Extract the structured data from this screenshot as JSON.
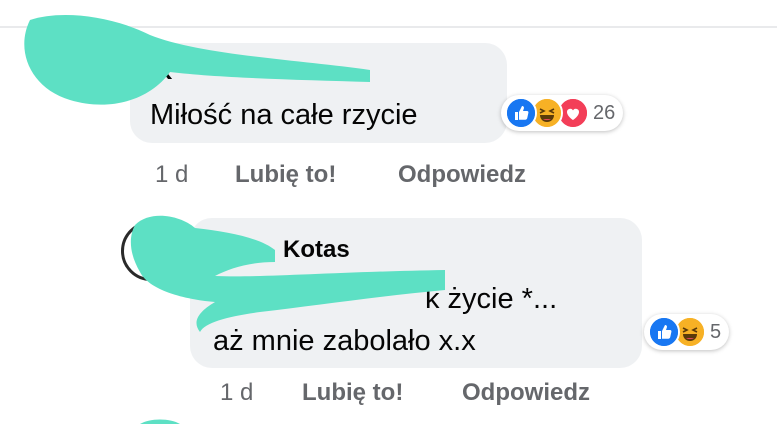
{
  "comments": [
    {
      "author": "K",
      "text": "Miłość na całe rzycie",
      "time": "1 d",
      "like_label": "Lubię to!",
      "reply_label": "Odpowiedz",
      "reaction_count": "26",
      "reaction_icons": [
        "like-icon",
        "haha-icon",
        "love-icon"
      ]
    },
    {
      "author": "Kotas",
      "text_line1": "k życie *...",
      "text_line2": "aż mnie zabolało x.x",
      "time": "1 d",
      "like_label": "Lubię to!",
      "reply_label": "Odpowiedz",
      "reaction_count": "5",
      "reaction_icons": [
        "like-icon",
        "haha-icon"
      ]
    }
  ],
  "colors": {
    "bubble": "#eff1f3",
    "meta_text": "#65676b",
    "like_blue": "#1877f2",
    "haha_yellow": "#f7b125",
    "love_red": "#f33e58",
    "scribble": "#5de0c4"
  }
}
